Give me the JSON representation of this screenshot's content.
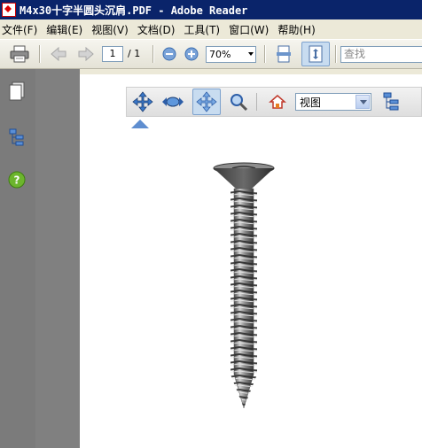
{
  "window": {
    "title": "M4x30十字半圆头沉肩.PDF - Adobe Reader"
  },
  "menu": [
    "文件(F)",
    "编辑(E)",
    "视图(V)",
    "文档(D)",
    "工具(T)",
    "窗口(W)",
    "帮助(H)"
  ],
  "toolbar": {
    "current_page": "1",
    "total_pages": "/ 1",
    "zoom": "70%",
    "search_placeholder": "查找",
    "icons": [
      "printer-icon",
      "previous-page-icon",
      "next-page-icon",
      "zoom-out-icon",
      "zoom-in-icon",
      "fit-width-icon",
      "fit-page-icon"
    ]
  },
  "nav_panel": {
    "icons": [
      "pages-icon",
      "bookmarks-icon",
      "help-icon"
    ]
  },
  "viewer3d": {
    "icons": [
      "rotate-icon",
      "spin-icon",
      "pan-icon",
      "zoom-icon",
      "home-view-icon",
      "model-tree-icon"
    ],
    "view_select": "视图"
  },
  "colors": {
    "title_bar": "#0a246a",
    "nav_panel": "#7b7b7b",
    "active_button": "#c8dcf0"
  }
}
